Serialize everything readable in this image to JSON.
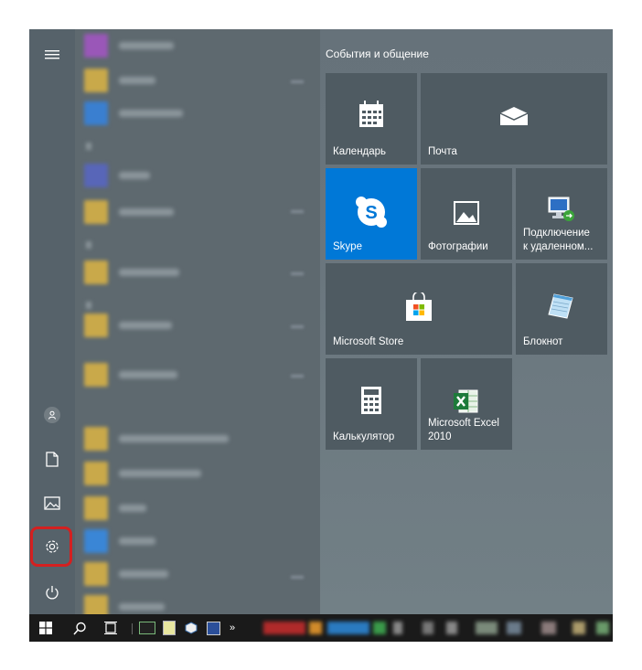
{
  "group_title": "События и общение",
  "tiles": {
    "calendar": "Календарь",
    "mail": "Почта",
    "skype": "Skype",
    "photos": "Фотографии",
    "remote": "Подключение\nк удаленном...",
    "store": "Microsoft Store",
    "notepad": "Блокнот",
    "calculator": "Калькулятор",
    "excel": "Microsoft Excel\n2010"
  },
  "rail_icons": [
    "hamburger-icon",
    "user-icon",
    "document-icon",
    "pictures-icon",
    "gear-icon",
    "power-icon"
  ],
  "taskbar": {
    "overflow": "»"
  },
  "colors": {
    "skype_tile": "#0078d7",
    "tile": "#4f5b62",
    "taskbar": "#1a1a1a",
    "highlight": "#d42020"
  }
}
